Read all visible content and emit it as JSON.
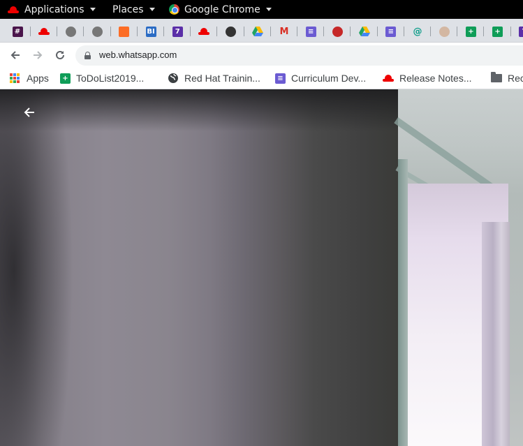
{
  "topbar": {
    "applications_label": "Applications",
    "places_label": "Places",
    "chrome_label": "Google Chrome"
  },
  "tabs": [
    {
      "icon": "slack-icon",
      "glyph": "#",
      "color": "#4a154b",
      "shape": "square"
    },
    {
      "icon": "redhat-icon",
      "glyph": "",
      "color": "#ee0000",
      "shape": "hat"
    },
    {
      "icon": "globe-icon",
      "glyph": "",
      "color": "#777777",
      "shape": "round"
    },
    {
      "icon": "globe-icon",
      "glyph": "",
      "color": "#777777",
      "shape": "round"
    },
    {
      "icon": "gitlab-icon",
      "glyph": "",
      "color": "#fc6d26",
      "shape": "square"
    },
    {
      "icon": "bi-icon",
      "glyph": "BI",
      "color": "#2b6cc4",
      "shape": "square"
    },
    {
      "icon": "seven-icon",
      "glyph": "7",
      "color": "#5b2fa8",
      "shape": "square"
    },
    {
      "icon": "redhat-icon",
      "glyph": "",
      "color": "#ee0000",
      "shape": "hat"
    },
    {
      "icon": "globe-icon",
      "glyph": "",
      "color": "#333333",
      "shape": "round"
    },
    {
      "icon": "google-drive-icon",
      "glyph": "",
      "color": "#1fa463",
      "shape": "triangle"
    },
    {
      "icon": "gmail-icon",
      "glyph": "M",
      "color": "#d93025",
      "shape": "text"
    },
    {
      "icon": "google-docs-icon",
      "glyph": "≡",
      "color": "#6b5bd2",
      "shape": "square"
    },
    {
      "icon": "bug-icon",
      "glyph": "",
      "color": "#c62828",
      "shape": "round"
    },
    {
      "icon": "google-drive-icon",
      "glyph": "",
      "color": "#1fa463",
      "shape": "triangle"
    },
    {
      "icon": "google-docs-icon",
      "glyph": "≡",
      "color": "#6b5bd2",
      "shape": "square"
    },
    {
      "icon": "at-icon",
      "glyph": "@",
      "color": "#0f9d8a",
      "shape": "text"
    },
    {
      "icon": "jenkins-icon",
      "glyph": "",
      "color": "#d3b7a2",
      "shape": "round"
    },
    {
      "icon": "google-sheets-icon",
      "glyph": "+",
      "color": "#0f9d58",
      "shape": "square"
    },
    {
      "icon": "google-sheets-icon",
      "glyph": "+",
      "color": "#0f9d58",
      "shape": "square"
    },
    {
      "icon": "seven-icon",
      "glyph": "7",
      "color": "#5b2fa8",
      "shape": "square"
    }
  ],
  "toolbar": {
    "url": "web.whatsapp.com"
  },
  "bookmarks": [
    {
      "label": "Apps",
      "icon": "apps-grid-icon"
    },
    {
      "label": "ToDoList2019...",
      "icon": "google-sheets-icon"
    },
    {
      "label": "Red Hat Trainin...",
      "icon": "globe-icon"
    },
    {
      "label": "Curriculum Dev...",
      "icon": "google-docs-icon"
    },
    {
      "label": "Release Notes...",
      "icon": "redhat-icon"
    },
    {
      "label": "Rec",
      "icon": "folder-icon"
    }
  ]
}
